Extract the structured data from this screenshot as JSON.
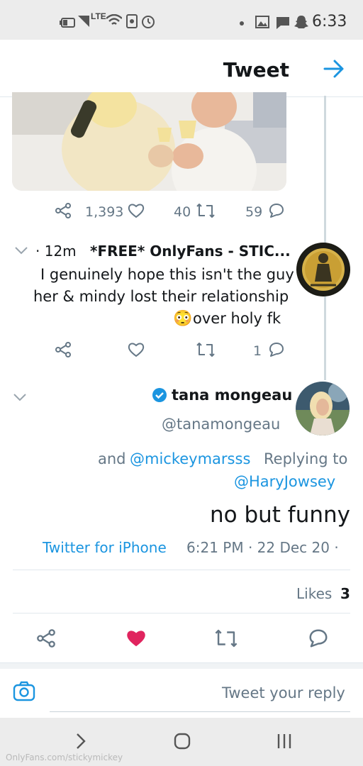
{
  "status_bar": {
    "time": "6:33",
    "network": "LTE"
  },
  "header": {
    "title": "Tweet"
  },
  "media_tweet_actions": {
    "replies": "59",
    "retweets": "40",
    "likes": "1,393"
  },
  "reply_tweet": {
    "name": "*FREE* OnlyFans - STIC...",
    "time": "· 12m",
    "text_line1": "I genuinely hope this isn't the guy",
    "text_line2": "her & mindy lost their relationship",
    "text_line3": "over holy fk",
    "emoji": "😳",
    "replies": "1"
  },
  "main_tweet": {
    "name": "tana mongeau",
    "handle": "@tanamongeau",
    "replying_prefix": "Replying to",
    "replying_user1": "@mickeymarsss",
    "replying_and": "and",
    "replying_user2": "@HaryJowsey",
    "text": "no but funny",
    "timestamp": "6:21 PM · 22 Dec 20 ·",
    "source": "Twitter for iPhone",
    "likes_count": "3",
    "likes_label": "Likes"
  },
  "reply_box": {
    "placeholder": "Tweet your reply"
  },
  "watermark": "OnlyFans.com/stickymickey",
  "colors": {
    "accent": "#1b95e0",
    "like": "#e0245e",
    "muted": "#657786"
  }
}
